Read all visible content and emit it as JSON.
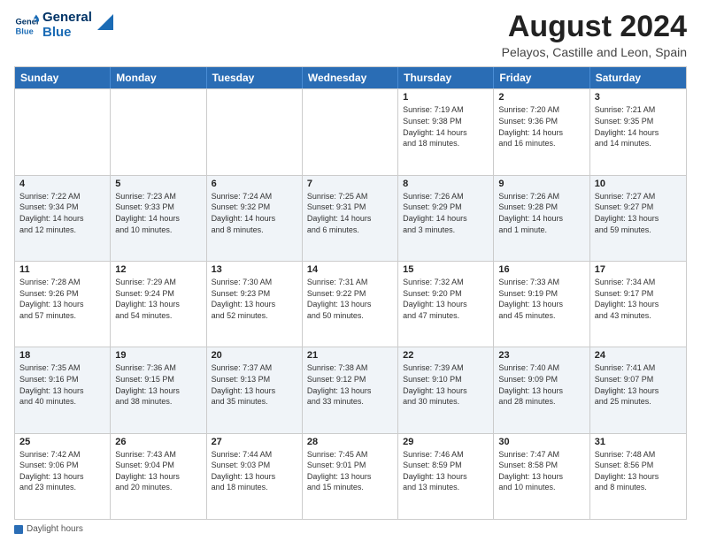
{
  "logo": {
    "line1": "General",
    "line2": "Blue"
  },
  "title": "August 2024",
  "subtitle": "Pelayos, Castille and Leon, Spain",
  "days_of_week": [
    "Sunday",
    "Monday",
    "Tuesday",
    "Wednesday",
    "Thursday",
    "Friday",
    "Saturday"
  ],
  "weeks": [
    [
      {
        "day": "",
        "info": ""
      },
      {
        "day": "",
        "info": ""
      },
      {
        "day": "",
        "info": ""
      },
      {
        "day": "",
        "info": ""
      },
      {
        "day": "1",
        "info": "Sunrise: 7:19 AM\nSunset: 9:38 PM\nDaylight: 14 hours\nand 18 minutes."
      },
      {
        "day": "2",
        "info": "Sunrise: 7:20 AM\nSunset: 9:36 PM\nDaylight: 14 hours\nand 16 minutes."
      },
      {
        "day": "3",
        "info": "Sunrise: 7:21 AM\nSunset: 9:35 PM\nDaylight: 14 hours\nand 14 minutes."
      }
    ],
    [
      {
        "day": "4",
        "info": "Sunrise: 7:22 AM\nSunset: 9:34 PM\nDaylight: 14 hours\nand 12 minutes."
      },
      {
        "day": "5",
        "info": "Sunrise: 7:23 AM\nSunset: 9:33 PM\nDaylight: 14 hours\nand 10 minutes."
      },
      {
        "day": "6",
        "info": "Sunrise: 7:24 AM\nSunset: 9:32 PM\nDaylight: 14 hours\nand 8 minutes."
      },
      {
        "day": "7",
        "info": "Sunrise: 7:25 AM\nSunset: 9:31 PM\nDaylight: 14 hours\nand 6 minutes."
      },
      {
        "day": "8",
        "info": "Sunrise: 7:26 AM\nSunset: 9:29 PM\nDaylight: 14 hours\nand 3 minutes."
      },
      {
        "day": "9",
        "info": "Sunrise: 7:26 AM\nSunset: 9:28 PM\nDaylight: 14 hours\nand 1 minute."
      },
      {
        "day": "10",
        "info": "Sunrise: 7:27 AM\nSunset: 9:27 PM\nDaylight: 13 hours\nand 59 minutes."
      }
    ],
    [
      {
        "day": "11",
        "info": "Sunrise: 7:28 AM\nSunset: 9:26 PM\nDaylight: 13 hours\nand 57 minutes."
      },
      {
        "day": "12",
        "info": "Sunrise: 7:29 AM\nSunset: 9:24 PM\nDaylight: 13 hours\nand 54 minutes."
      },
      {
        "day": "13",
        "info": "Sunrise: 7:30 AM\nSunset: 9:23 PM\nDaylight: 13 hours\nand 52 minutes."
      },
      {
        "day": "14",
        "info": "Sunrise: 7:31 AM\nSunset: 9:22 PM\nDaylight: 13 hours\nand 50 minutes."
      },
      {
        "day": "15",
        "info": "Sunrise: 7:32 AM\nSunset: 9:20 PM\nDaylight: 13 hours\nand 47 minutes."
      },
      {
        "day": "16",
        "info": "Sunrise: 7:33 AM\nSunset: 9:19 PM\nDaylight: 13 hours\nand 45 minutes."
      },
      {
        "day": "17",
        "info": "Sunrise: 7:34 AM\nSunset: 9:17 PM\nDaylight: 13 hours\nand 43 minutes."
      }
    ],
    [
      {
        "day": "18",
        "info": "Sunrise: 7:35 AM\nSunset: 9:16 PM\nDaylight: 13 hours\nand 40 minutes."
      },
      {
        "day": "19",
        "info": "Sunrise: 7:36 AM\nSunset: 9:15 PM\nDaylight: 13 hours\nand 38 minutes."
      },
      {
        "day": "20",
        "info": "Sunrise: 7:37 AM\nSunset: 9:13 PM\nDaylight: 13 hours\nand 35 minutes."
      },
      {
        "day": "21",
        "info": "Sunrise: 7:38 AM\nSunset: 9:12 PM\nDaylight: 13 hours\nand 33 minutes."
      },
      {
        "day": "22",
        "info": "Sunrise: 7:39 AM\nSunset: 9:10 PM\nDaylight: 13 hours\nand 30 minutes."
      },
      {
        "day": "23",
        "info": "Sunrise: 7:40 AM\nSunset: 9:09 PM\nDaylight: 13 hours\nand 28 minutes."
      },
      {
        "day": "24",
        "info": "Sunrise: 7:41 AM\nSunset: 9:07 PM\nDaylight: 13 hours\nand 25 minutes."
      }
    ],
    [
      {
        "day": "25",
        "info": "Sunrise: 7:42 AM\nSunset: 9:06 PM\nDaylight: 13 hours\nand 23 minutes."
      },
      {
        "day": "26",
        "info": "Sunrise: 7:43 AM\nSunset: 9:04 PM\nDaylight: 13 hours\nand 20 minutes."
      },
      {
        "day": "27",
        "info": "Sunrise: 7:44 AM\nSunset: 9:03 PM\nDaylight: 13 hours\nand 18 minutes."
      },
      {
        "day": "28",
        "info": "Sunrise: 7:45 AM\nSunset: 9:01 PM\nDaylight: 13 hours\nand 15 minutes."
      },
      {
        "day": "29",
        "info": "Sunrise: 7:46 AM\nSunset: 8:59 PM\nDaylight: 13 hours\nand 13 minutes."
      },
      {
        "day": "30",
        "info": "Sunrise: 7:47 AM\nSunset: 8:58 PM\nDaylight: 13 hours\nand 10 minutes."
      },
      {
        "day": "31",
        "info": "Sunrise: 7:48 AM\nSunset: 8:56 PM\nDaylight: 13 hours\nand 8 minutes."
      }
    ]
  ],
  "footer": {
    "label": "Daylight hours"
  },
  "colors": {
    "header_bg": "#2a6db5",
    "alt_row": "#e8eef5"
  }
}
